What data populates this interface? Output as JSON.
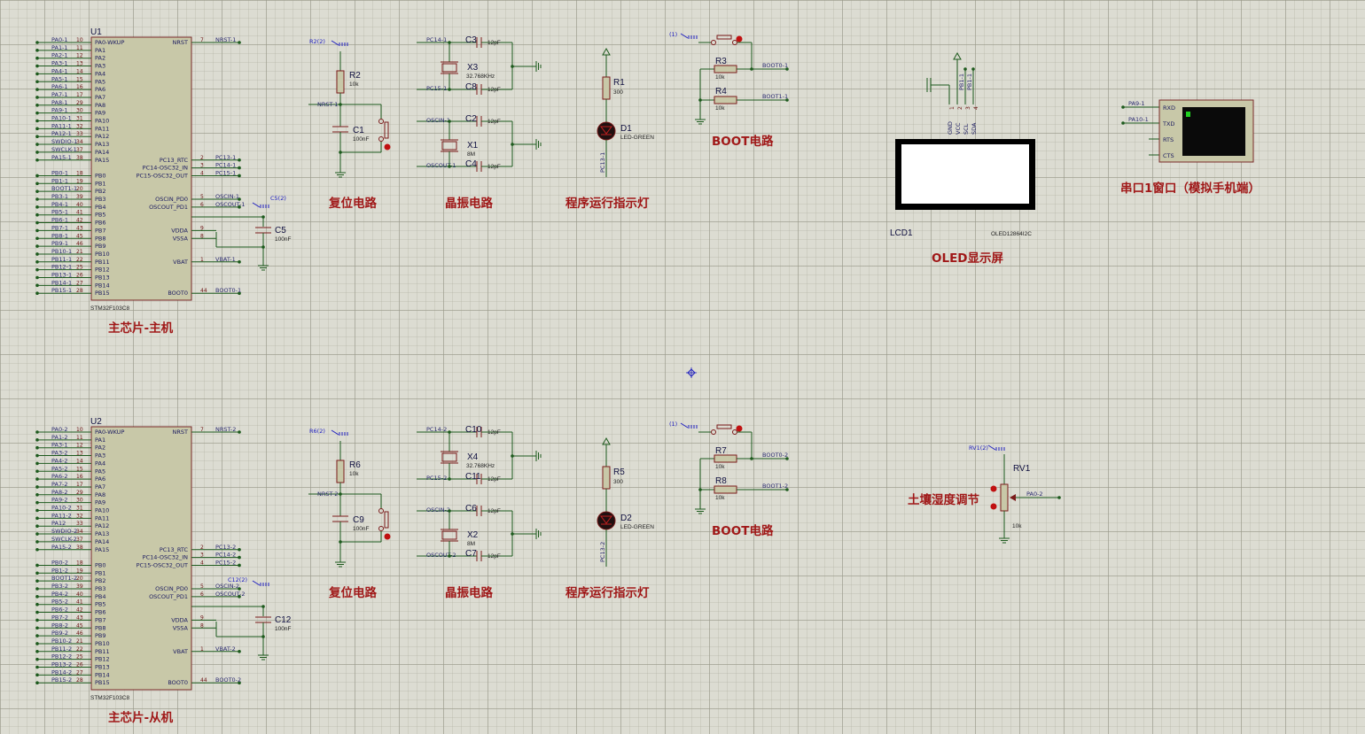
{
  "u1": {
    "ref": "U1",
    "part": "STM32F103C8",
    "left_pins": [
      {
        "net": "PA0-1",
        "num": "10",
        "name": "PA0-WKUP"
      },
      {
        "net": "PA1-1",
        "num": "11",
        "name": "PA1"
      },
      {
        "net": "PA2-1",
        "num": "12",
        "name": "PA2"
      },
      {
        "net": "PA3-1",
        "num": "13",
        "name": "PA3"
      },
      {
        "net": "PA4-1",
        "num": "14",
        "name": "PA4"
      },
      {
        "net": "PA5-1",
        "num": "15",
        "name": "PA5"
      },
      {
        "net": "PA6-1",
        "num": "16",
        "name": "PA6"
      },
      {
        "net": "PA7-1",
        "num": "17",
        "name": "PA7"
      },
      {
        "net": "PA8-1",
        "num": "29",
        "name": "PA8"
      },
      {
        "net": "PA9-1",
        "num": "30",
        "name": "PA9"
      },
      {
        "net": "PA10-1",
        "num": "31",
        "name": "PA10"
      },
      {
        "net": "PA11-1",
        "num": "32",
        "name": "PA11"
      },
      {
        "net": "PA12-1",
        "num": "33",
        "name": "PA12"
      },
      {
        "net": "SWDIO-1",
        "num": "34",
        "name": "PA13"
      },
      {
        "net": "SWCLK-1",
        "num": "37",
        "name": "PA14"
      },
      {
        "net": "PA15-1",
        "num": "38",
        "name": "PA15"
      },
      {
        "net": "",
        "num": "",
        "name": ""
      },
      {
        "net": "PB0-1",
        "num": "18",
        "name": "PB0"
      },
      {
        "net": "PB1-1",
        "num": "19",
        "name": "PB1"
      },
      {
        "net": "BOOT1-1",
        "num": "20",
        "name": "PB2"
      },
      {
        "net": "PB3-1",
        "num": "39",
        "name": "PB3"
      },
      {
        "net": "PB4-1",
        "num": "40",
        "name": "PB4"
      },
      {
        "net": "PB5-1",
        "num": "41",
        "name": "PB5"
      },
      {
        "net": "PB6-1",
        "num": "42",
        "name": "PB6"
      },
      {
        "net": "PB7-1",
        "num": "43",
        "name": "PB7"
      },
      {
        "net": "PB8-1",
        "num": "45",
        "name": "PB8"
      },
      {
        "net": "PB9-1",
        "num": "46",
        "name": "PB9"
      },
      {
        "net": "PB10-1",
        "num": "21",
        "name": "PB10"
      },
      {
        "net": "PB11-1",
        "num": "22",
        "name": "PB11"
      },
      {
        "net": "PB12-1",
        "num": "25",
        "name": "PB12"
      },
      {
        "net": "PB13-1",
        "num": "26",
        "name": "PB13"
      },
      {
        "net": "PB14-1",
        "num": "27",
        "name": "PB14"
      },
      {
        "net": "PB15-1",
        "num": "28",
        "name": "PB15"
      }
    ],
    "right_pins": [
      {
        "row": 0,
        "num": "7",
        "name": "NRST",
        "net": "NRST-1"
      },
      {
        "row": 15,
        "num": "2",
        "name": "PC13_RTC",
        "net": "PC13-1"
      },
      {
        "row": 16,
        "num": "3",
        "name": "PC14-OSC32_IN",
        "net": "PC14-1"
      },
      {
        "row": 17,
        "num": "4",
        "name": "PC15-OSC32_OUT",
        "net": "PC15-1"
      },
      {
        "row": 20,
        "num": "5",
        "name": "OSCIN_PD0",
        "net": "OSCIN-1"
      },
      {
        "row": 21,
        "num": "6",
        "name": "OSCOUT_PD1",
        "net": "OSCOUT-1"
      },
      {
        "row": 24,
        "num": "9",
        "name": "VDDA",
        "net": ""
      },
      {
        "row": 25,
        "num": "8",
        "name": "VSSA",
        "net": ""
      },
      {
        "row": 28,
        "num": "1",
        "name": "VBAT",
        "net": "VBAT-1"
      },
      {
        "row": 32,
        "num": "44",
        "name": "BOOT0",
        "net": "BOOT0-1"
      }
    ],
    "cap_ref": "C5",
    "cap_val": "100nF",
    "cap_bus": "C5(2)",
    "title": "主芯片-主机"
  },
  "u2": {
    "ref": "U2",
    "part": "STM32F103C8",
    "left_pins": [
      {
        "net": "PA0-2",
        "num": "10",
        "name": "PA0-WKUP"
      },
      {
        "net": "PA1-2",
        "num": "11",
        "name": "PA1"
      },
      {
        "net": "PA3-1",
        "num": "12",
        "name": "PA2"
      },
      {
        "net": "PA3-2",
        "num": "13",
        "name": "PA3"
      },
      {
        "net": "PA4-2",
        "num": "14",
        "name": "PA4"
      },
      {
        "net": "PA5-2",
        "num": "15",
        "name": "PA5"
      },
      {
        "net": "PA6-2",
        "num": "16",
        "name": "PA6"
      },
      {
        "net": "PA7-2",
        "num": "17",
        "name": "PA7"
      },
      {
        "net": "PA8-2",
        "num": "29",
        "name": "PA8"
      },
      {
        "net": "PA9-2",
        "num": "30",
        "name": "PA9"
      },
      {
        "net": "PA10-2",
        "num": "31",
        "name": "PA10"
      },
      {
        "net": "PA11-2",
        "num": "32",
        "name": "PA11"
      },
      {
        "net": "PA12",
        "num": "33",
        "name": "PA12"
      },
      {
        "net": "SWDIO-2",
        "num": "34",
        "name": "PA13"
      },
      {
        "net": "SWCLK-2",
        "num": "37",
        "name": "PA14"
      },
      {
        "net": "PA15-2",
        "num": "38",
        "name": "PA15"
      },
      {
        "net": "",
        "num": "",
        "name": ""
      },
      {
        "net": "PB0-2",
        "num": "18",
        "name": "PB0"
      },
      {
        "net": "PB1-2",
        "num": "19",
        "name": "PB1"
      },
      {
        "net": "BOOT1-2",
        "num": "20",
        "name": "PB2"
      },
      {
        "net": "PB3-2",
        "num": "39",
        "name": "PB3"
      },
      {
        "net": "PB4-2",
        "num": "40",
        "name": "PB4"
      },
      {
        "net": "PB5-2",
        "num": "41",
        "name": "PB5"
      },
      {
        "net": "PB6-2",
        "num": "42",
        "name": "PB6"
      },
      {
        "net": "PB7-2",
        "num": "43",
        "name": "PB7"
      },
      {
        "net": "PB8-2",
        "num": "45",
        "name": "PB8"
      },
      {
        "net": "PB9-2",
        "num": "46",
        "name": "PB9"
      },
      {
        "net": "PB10-2",
        "num": "21",
        "name": "PB10"
      },
      {
        "net": "PB11-2",
        "num": "22",
        "name": "PB11"
      },
      {
        "net": "PB12-2",
        "num": "25",
        "name": "PB12"
      },
      {
        "net": "PB13-2",
        "num": "26",
        "name": "PB13"
      },
      {
        "net": "PB14-2",
        "num": "27",
        "name": "PB14"
      },
      {
        "net": "PB15-2",
        "num": "28",
        "name": "PB15"
      }
    ],
    "right_pins": [
      {
        "row": 0,
        "num": "7",
        "name": "NRST",
        "net": "NRST-2"
      },
      {
        "row": 15,
        "num": "2",
        "name": "PC13_RTC",
        "net": "PC13-2"
      },
      {
        "row": 16,
        "num": "3",
        "name": "PC14-OSC32_IN",
        "net": "PC14-2"
      },
      {
        "row": 17,
        "num": "4",
        "name": "PC15-OSC32_OUT",
        "net": "PC15-2"
      },
      {
        "row": 20,
        "num": "5",
        "name": "OSCIN_PD0",
        "net": "OSCIN-2"
      },
      {
        "row": 21,
        "num": "6",
        "name": "OSCOUT_PD1",
        "net": "OSCOUT-2"
      },
      {
        "row": 24,
        "num": "9",
        "name": "VDDA",
        "net": ""
      },
      {
        "row": 25,
        "num": "8",
        "name": "VSSA",
        "net": ""
      },
      {
        "row": 28,
        "num": "1",
        "name": "VBAT",
        "net": "VBAT-2"
      },
      {
        "row": 32,
        "num": "44",
        "name": "BOOT0",
        "net": "BOOT0-2"
      }
    ],
    "cap_ref": "C12",
    "cap_val": "100nF",
    "cap_bus": "C12(2)",
    "title": "主芯片-从机"
  },
  "reset1": {
    "bus": "R2(2)",
    "r_ref": "R2",
    "r_val": "10k",
    "net": "NRST-1",
    "c_ref": "C1",
    "c_val": "100nF",
    "title": "复位电路"
  },
  "reset2": {
    "bus": "R6(2)",
    "r_ref": "R6",
    "r_val": "10k",
    "net": "NRST-2",
    "c_ref": "C9",
    "c_val": "100nF",
    "title": "复位电路"
  },
  "osc1": {
    "net_a": "PC14-1",
    "net_b": "PC15-1",
    "c_a": "C3",
    "c_b": "C8",
    "x_a": "X3",
    "x_a_val": "32.768KHz",
    "net_c": "OSCIN-1",
    "net_d": "OSCOUT-1",
    "c_c": "C2",
    "c_d": "C4",
    "x_b": "X1",
    "x_b_val": "8M",
    "cval": "12pF",
    "title": "晶振电路"
  },
  "osc2": {
    "net_a": "PC14-2",
    "net_b": "PC15-2",
    "c_a": "C10",
    "c_b": "C11",
    "x_a": "X4",
    "x_a_val": "32.768KHz",
    "net_c": "OSCIN-2",
    "net_d": "OSCOUT-2",
    "c_c": "C6",
    "c_d": "C7",
    "x_b": "X2",
    "x_b_val": "8M",
    "cval": "12pF",
    "title": "晶振电路"
  },
  "led1": {
    "r_ref": "R1",
    "r_val": "300",
    "d_ref": "D1",
    "d_val": "LED-GREEN",
    "net": "PC13-1",
    "title": "程序运行指示灯"
  },
  "led2": {
    "r_ref": "R5",
    "r_val": "300",
    "d_ref": "D2",
    "d_val": "LED-GREEN",
    "net": "PC13-2",
    "title": "程序运行指示灯"
  },
  "boot1": {
    "bus": "(1)",
    "r_a": "R3",
    "r_a_val": "10k",
    "net_a": "BOOT0-1",
    "r_b": "R4",
    "r_b_val": "10k",
    "net_b": "BOOT1-1",
    "title": "BOOT电路"
  },
  "boot2": {
    "bus": "(1)",
    "r_a": "R7",
    "r_a_val": "10k",
    "net_a": "BOOT0-2",
    "r_b": "R8",
    "r_b_val": "10k",
    "net_b": "BOOT1-2",
    "title": "BOOT电路"
  },
  "oled": {
    "ref": "LCD1",
    "part": "OLED12864I2C",
    "pins": [
      "GND",
      "VCC",
      "SCL",
      "SDA"
    ],
    "pin_nums": [
      "1",
      "2",
      "3",
      "4"
    ],
    "nets": [
      "PB1-1",
      "PB1-1"
    ],
    "title": "OLED显示屏"
  },
  "uart": {
    "net_rx": "PA9-1",
    "net_tx": "PA10-1",
    "pins": [
      "RXD",
      "TXD",
      "RTS",
      "CTS"
    ],
    "title": "串口1窗口（模拟手机端）"
  },
  "pot": {
    "bus": "RV1(2)",
    "ref": "RV1",
    "val": "10k",
    "net": "PA0-2",
    "title": "土壤湿度调节"
  },
  "colors": {
    "background": "#dcdcd2",
    "wire": "#1d5a1d",
    "component": "#7a1a1a",
    "title": "#a01818",
    "bus": "#2020c0"
  }
}
